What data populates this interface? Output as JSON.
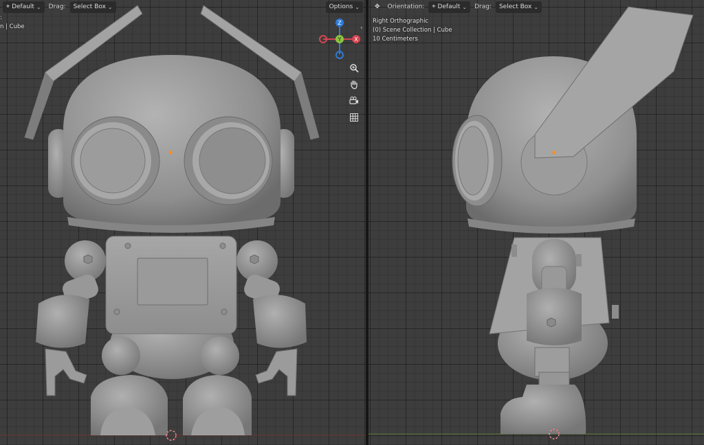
{
  "left_viewport": {
    "header": {
      "transform_pivot_icon": "transform-orientation-icon",
      "orientation_value": "Default",
      "drag_label": "Drag:",
      "drag_value": "Select Box",
      "options_label": "Options"
    },
    "overlay": {
      "line1": ":",
      "line2": "n | Cube"
    },
    "gizmo": {
      "z": "Z",
      "y": "Y",
      "x": "X"
    },
    "nav_icons": [
      "zoom-icon",
      "hand-pan-icon",
      "camera-icon",
      "grid-icon"
    ]
  },
  "right_viewport": {
    "header": {
      "transform_icon": "move-arrows-icon",
      "orientation_label": "Orientation:",
      "orientation_value": "Default",
      "drag_label": "Drag:",
      "drag_value": "Select Box"
    },
    "overlay": {
      "view_name": "Right Orthographic",
      "collection": "(0) Scene Collection | Cube",
      "scale": "10 Centimeters"
    }
  },
  "colors": {
    "viewport_bg": "#3d3d3d",
    "model": "#9a9a9a",
    "axis_x": "#d64550",
    "axis_y": "#8cc63f",
    "axis_z": "#2e7bd6",
    "origin_dot": "#ff8c1a"
  }
}
